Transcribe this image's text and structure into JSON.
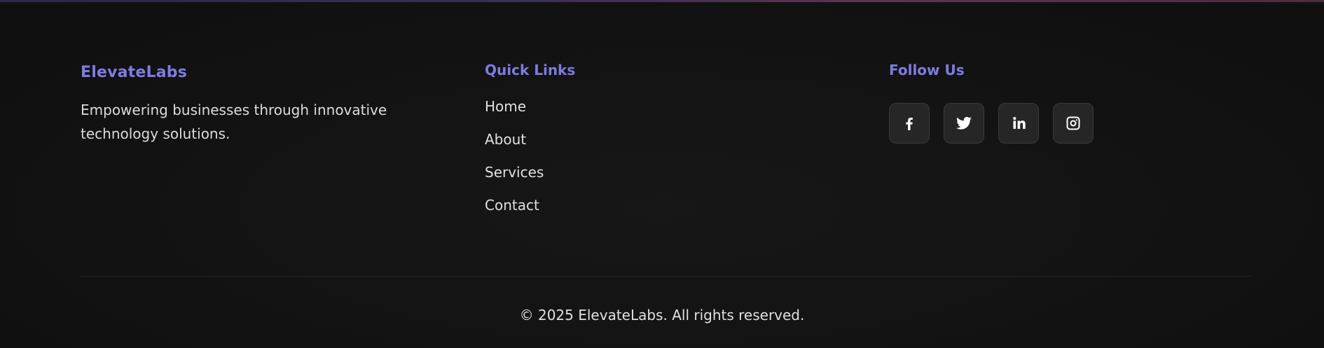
{
  "brand": {
    "name": "ElevateLabs",
    "tagline": "Empowering businesses through innovative technology solutions."
  },
  "quick_links": {
    "heading": "Quick Links",
    "items": [
      {
        "label": "Home"
      },
      {
        "label": "About"
      },
      {
        "label": "Services"
      },
      {
        "label": "Contact"
      }
    ]
  },
  "social": {
    "heading": "Follow Us",
    "items": [
      {
        "icon": "facebook-icon"
      },
      {
        "icon": "twitter-icon"
      },
      {
        "icon": "linkedin-icon"
      },
      {
        "icon": "instagram-icon"
      }
    ]
  },
  "footer": {
    "copyright": "© 2025 ElevateLabs. All rights reserved."
  },
  "colors": {
    "accent": "#7c7ce3",
    "background": "#111111",
    "text": "#e0e0e0",
    "button_bg": "#262626"
  }
}
